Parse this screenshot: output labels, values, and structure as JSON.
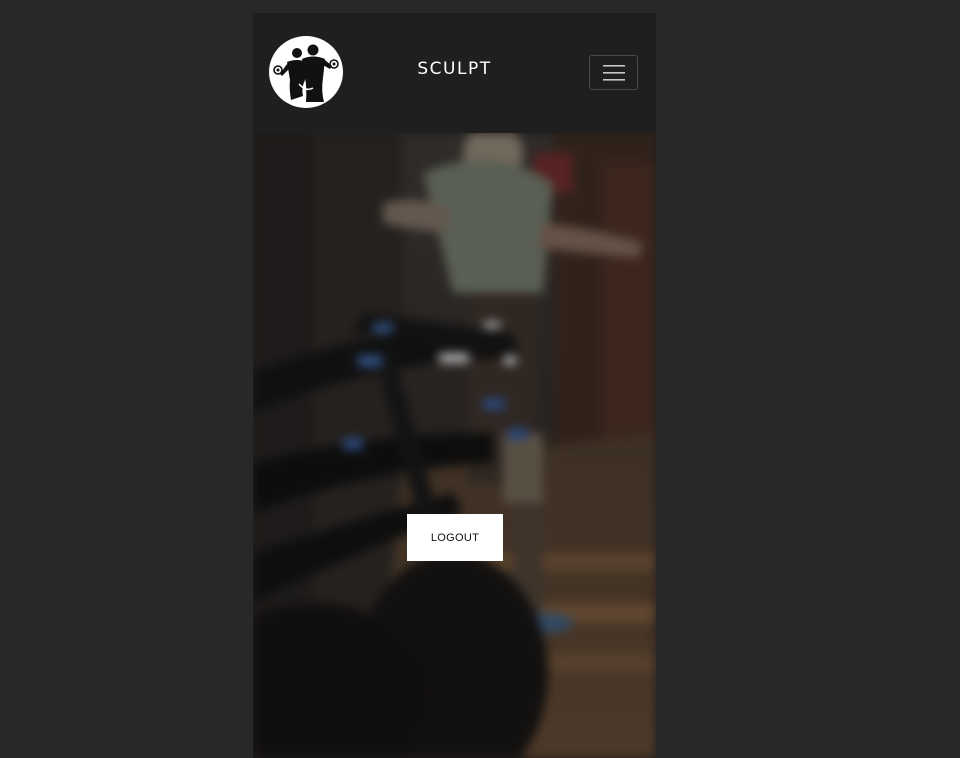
{
  "navbar": {
    "brand": "SCULPT",
    "logo_icon": "bodybuilders-dumbbell-logo-icon",
    "menu_icon": "hamburger-menu-icon"
  },
  "hero": {
    "background": "blurred-gym-spin-bikes-image",
    "logout_label": "LOGOUT"
  },
  "colors": {
    "page_background": "#282828",
    "navbar_background": "#1f1f1f",
    "brand_text": "#ffffff",
    "button_background": "#ffffff",
    "button_text": "#111111"
  }
}
